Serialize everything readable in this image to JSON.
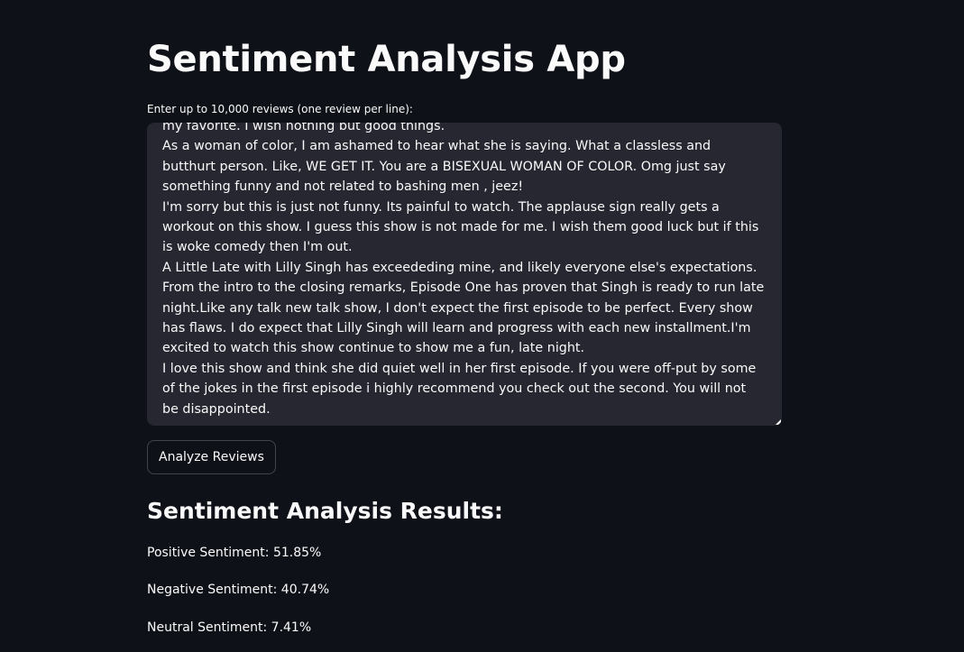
{
  "app": {
    "title": "Sentiment Analysis App"
  },
  "input": {
    "label": "Enter up to 10,000 reviews (one review per line):",
    "value": "my favorite. I wish nothing but good things.\nAs a woman of color, I am ashamed to hear what she is saying. What a classless and butthurt person. Like, WE GET IT. You are a BISEXUAL WOMAN OF COLOR. Omg just say something funny and not related to bashing men , jeez!\nI'm sorry but this is just not funny. Its painful to watch. The applause sign really gets a workout on this show. I guess this show is not made for me. I wish them good luck but if this is woke comedy then I'm out.\nA Little Late with Lilly Singh has exceededing mine, and likely everyone else's expectations. From the intro to the closing remarks, Episode One has proven that Singh is ready to run late night.Like any talk new talk show, I don't expect the first episode to be perfect. Every show has flaws. I do expect that Lilly Singh will learn and progress with each new installment.I'm excited to watch this show continue to show me a fun, late night.\nI love this show and think she did quiet well in her first episode. If you were off-put by some of the jokes in the first episode i highly recommend you check out the second. You will not be disappointed."
  },
  "actions": {
    "analyze_label": "Analyze Reviews"
  },
  "results": {
    "heading": "Sentiment Analysis Results:",
    "positive": "Positive Sentiment: 51.85%",
    "negative": "Negative Sentiment: 40.74%",
    "neutral": "Neutral Sentiment: 7.41%"
  },
  "colors": {
    "background": "#0e1117",
    "input_background": "#262730",
    "text": "#fafafa"
  }
}
